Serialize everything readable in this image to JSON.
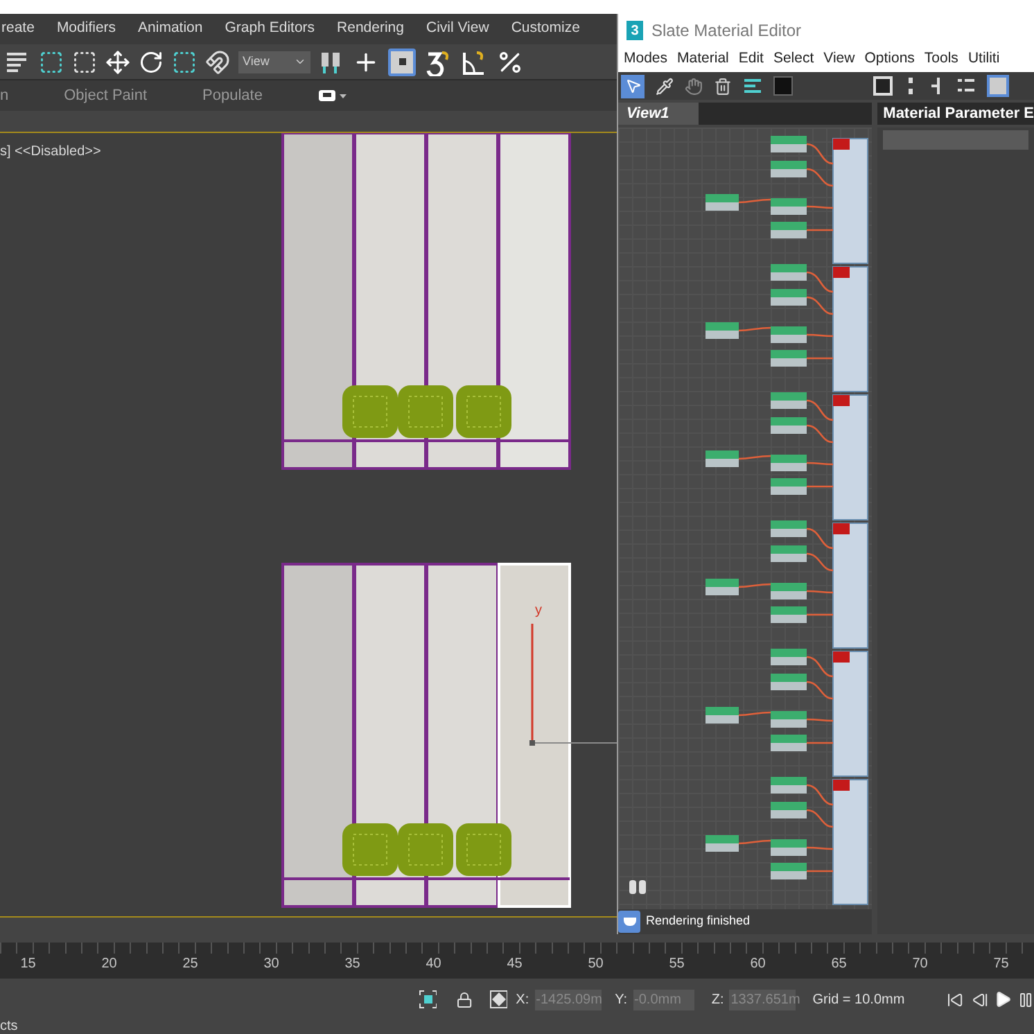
{
  "menu_bar": [
    "reate",
    "Modifiers",
    "Animation",
    "Graph Editors",
    "Rendering",
    "Civil View",
    "Customize"
  ],
  "toolbar": {
    "view_dropdown": "View"
  },
  "ribbon_tabs": [
    "n",
    "Object Paint",
    "Populate"
  ],
  "viewport": {
    "label": "s] <<Disabled>>",
    "axis_label": "y"
  },
  "slate_editor": {
    "app_badge": "3",
    "title": "Slate Material Editor",
    "menu": [
      "Modes",
      "Material",
      "Edit",
      "Select",
      "View",
      "Options",
      "Tools",
      "Utiliti"
    ],
    "view_tab": "View1",
    "param_panel_title": "Material Parameter E",
    "status": "Rendering finished"
  },
  "timeline": {
    "ticks": [
      "15",
      "20",
      "25",
      "30",
      "35",
      "40",
      "45",
      "50",
      "55",
      "60",
      "65",
      "70",
      "75"
    ]
  },
  "status_bar": {
    "x_label": "X:",
    "x": "-1425.09m",
    "y_label": "Y:",
    "y": "-0.0mm",
    "z_label": "Z:",
    "z": "1337.651m",
    "grid": "Grid = 10.0mm"
  },
  "prompt": "cts"
}
